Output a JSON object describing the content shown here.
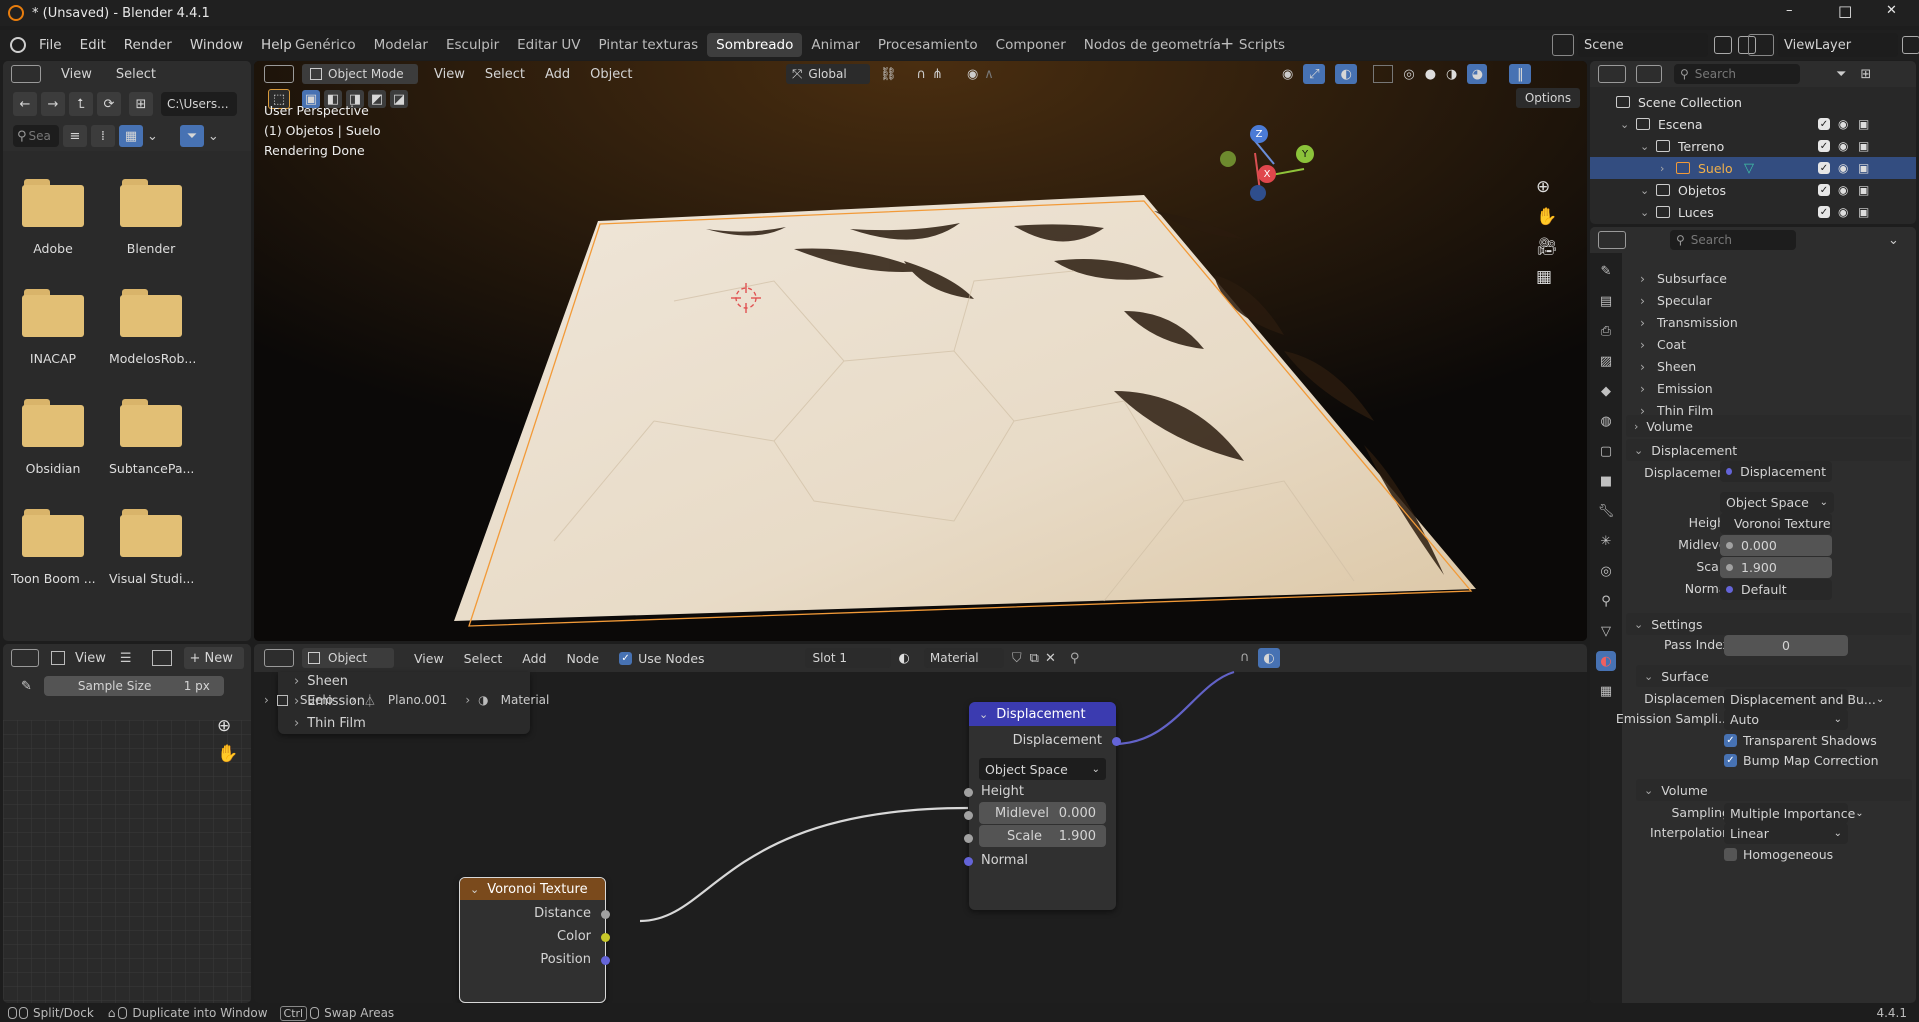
{
  "window": {
    "title": "* (Unsaved) - Blender 4.4.1",
    "minimize": "–",
    "maximize": "□",
    "close": "✕"
  },
  "menu": [
    "File",
    "Edit",
    "Render",
    "Window",
    "Help"
  ],
  "workspaces": [
    "Genérico",
    "Modelar",
    "Esculpir",
    "Editar UV",
    "Pintar texturas",
    "Sombreado",
    "Animar",
    "Procesamiento",
    "Componer",
    "Nodos de geometría",
    "Scripts"
  ],
  "add_workspace": "+",
  "scene": "Scene",
  "viewlayer": "ViewLayer",
  "filebrowser": {
    "menus": [
      "View",
      "Select"
    ],
    "path": "C:\\Users...",
    "search_placeholder": "Sea",
    "folders": [
      "Adobe",
      "Blender",
      "INACAP",
      "ModelosRob...",
      "Obsidian",
      "SubtancePa...",
      "Toon Boom ...",
      "Visual Studi..."
    ]
  },
  "viewport": {
    "mode": "Object Mode",
    "menus": [
      "View",
      "Select",
      "Add",
      "Object"
    ],
    "orientation": "Global",
    "options": "Options",
    "overlay": [
      "User Perspective",
      "(1) Objetos | Suelo",
      "Rendering Done"
    ],
    "gizmo": {
      "x": "X",
      "y": "Y",
      "z": "Z"
    }
  },
  "imageeditor": {
    "menu": "View",
    "new": "New",
    "sample_label": "Sample Size",
    "sample_value": "1 px"
  },
  "nodeeditor": {
    "type": "Object",
    "menus": [
      "View",
      "Select",
      "Add",
      "Node"
    ],
    "use_nodes": "Use Nodes",
    "slot": "Slot 1",
    "material": "Material",
    "breadcrumb": [
      "Suelo",
      "Plano.001",
      "Material"
    ],
    "popup_items": [
      "Sheen",
      "Emission",
      "Thin Film"
    ],
    "displacement_node": {
      "title": "Displacement",
      "output": "Displacement",
      "space": "Object Space",
      "height": "Height",
      "midlevel_label": "Midlevel",
      "midlevel": "0.000",
      "scale_label": "Scale",
      "scale": "1.900",
      "normal": "Normal"
    },
    "voronoi_node": {
      "title": "Voronoi Texture",
      "outputs": [
        "Distance",
        "Color",
        "Position"
      ]
    }
  },
  "outliner": {
    "search_placeholder": "Search",
    "items": [
      {
        "label": "Scene Collection",
        "depth": 0
      },
      {
        "label": "Escena",
        "depth": 1
      },
      {
        "label": "Terreno",
        "depth": 2
      },
      {
        "label": "Suelo",
        "depth": 3,
        "selected": true
      },
      {
        "label": "Objetos",
        "depth": 2
      },
      {
        "label": "Luces",
        "depth": 2
      }
    ]
  },
  "properties": {
    "search_placeholder": "Search",
    "subpanels": [
      "Subsurface",
      "Specular",
      "Transmission",
      "Coat",
      "Sheen",
      "Emission",
      "Thin Film"
    ],
    "volume": "Volume",
    "displacement": {
      "title": "Displacement",
      "disp_label": "Displacement",
      "disp_value": "Displacement",
      "space": "Object Space",
      "height_label": "Height",
      "height_value": "Voronoi Texture",
      "midlevel_label": "Midlevel",
      "midlevel": "0.000",
      "scale_label": "Scale",
      "scale": "1.900",
      "normal_label": "Normal",
      "normal_value": "Default"
    },
    "settings": {
      "title": "Settings",
      "pass_index_label": "Pass Index",
      "pass_index": "0",
      "surface": "Surface",
      "disp_label": "Displacement",
      "disp_value": "Displacement and Bu...",
      "emission_label": "Emission Sampli...",
      "emission_value": "Auto",
      "transparent_shadows": "Transparent Shadows",
      "bump_map": "Bump Map Correction",
      "volume": "Volume",
      "sampling_label": "Sampling",
      "sampling_value": "Multiple Importance",
      "interp_label": "Interpolation",
      "interp_value": "Linear",
      "homogeneous": "Homogeneous"
    }
  },
  "statusbar": {
    "split": "Split/Dock",
    "duplicate": "Duplicate into Window",
    "ctrl": "Ctrl",
    "swap": "Swap Areas",
    "version": "4.4.1"
  },
  "colors": {
    "accent": "#4772b3",
    "selected_row": "#334d80",
    "node_displacement": "#3b3bb0",
    "node_voronoi": "#7a4a1c",
    "terrain": "#e9dcc9",
    "origin": "#f29a38"
  }
}
